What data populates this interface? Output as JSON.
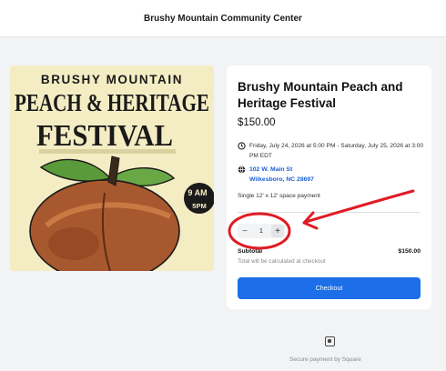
{
  "header": {
    "title": "Brushy Mountain Community Center"
  },
  "poster": {
    "line1": "BRUSHY MOUNTAIN",
    "line2": "PEACH & HERITAGE",
    "line3": "FESTIVAL",
    "badge_top": "9 AM",
    "badge_mid": "TO",
    "badge_bottom": "5PM"
  },
  "event": {
    "title": "Brushy Mountain Peach and Heritage Festival",
    "price": "$150.00",
    "date_text": "Friday, July 24, 2026 at 5:00 PM - Saturday, July 25, 2026 at 3:00 PM EDT",
    "address_line1": "102 W. Main St",
    "address_line2": "Wilkesboro, NC 28697",
    "description": "Single 12' x 12' space payment"
  },
  "cart": {
    "quantity": "1",
    "minus_label": "−",
    "plus_label": "+",
    "subtotal_label": "Subtotal",
    "subtotal_value": "$150.00",
    "total_note": "Total will be calculated at checkout",
    "checkout_label": "Checkout"
  },
  "footer": {
    "secure_text": "Secure payment by Square"
  },
  "icons": {
    "date": "clock-icon",
    "location": "globe-icon",
    "brand": "square-logo-icon"
  },
  "colors": {
    "accent": "#1c6fe8",
    "link": "#1a5fd6",
    "annotation": "#e01b24"
  }
}
